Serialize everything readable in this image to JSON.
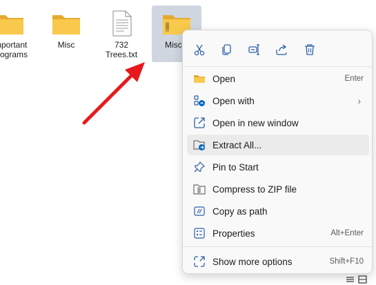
{
  "desktop": {
    "items": [
      {
        "label": "Important\nPrograms",
        "icon": "folder-icon"
      },
      {
        "label": "Misc",
        "icon": "folder-icon"
      },
      {
        "label": "732\nTrees.txt",
        "icon": "text-file-icon"
      },
      {
        "label": "Misc.z",
        "icon": "zip-folder-icon"
      }
    ]
  },
  "context_menu": {
    "quick_actions": [
      {
        "name": "cut",
        "icon": "scissors-icon"
      },
      {
        "name": "copy",
        "icon": "copy-icon"
      },
      {
        "name": "rename",
        "icon": "rename-icon"
      },
      {
        "name": "share",
        "icon": "share-icon"
      },
      {
        "name": "delete",
        "icon": "trash-icon"
      }
    ],
    "items": [
      {
        "label": "Open",
        "shortcut": "Enter"
      },
      {
        "label": "Open with",
        "shortcut": "",
        "submenu": true
      },
      {
        "label": "Open in new window",
        "shortcut": ""
      },
      {
        "label": "Extract All...",
        "shortcut": ""
      },
      {
        "label": "Pin to Start",
        "shortcut": ""
      },
      {
        "label": "Compress to ZIP file",
        "shortcut": ""
      },
      {
        "label": "Copy as path",
        "shortcut": ""
      },
      {
        "label": "Properties",
        "shortcut": "Alt+Enter"
      },
      {
        "label": "Show more options",
        "shortcut": "Shift+F10"
      }
    ]
  },
  "colors": {
    "folder": "#f8c94c",
    "accent": "#0067c0",
    "arrow": "#e8191c"
  }
}
